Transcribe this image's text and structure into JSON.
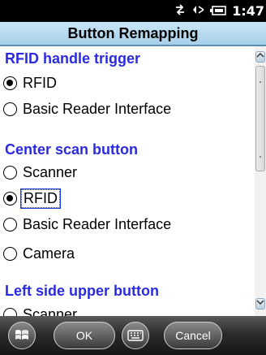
{
  "status_bar": {
    "time": "1:47",
    "icons": [
      "network-sync-icon",
      "speaker-icon",
      "battery-icon"
    ]
  },
  "title": "Button Remapping",
  "sections": [
    {
      "heading": "RFID handle trigger",
      "options": [
        {
          "label": "RFID",
          "checked": true
        },
        {
          "label": "Basic Reader Interface",
          "checked": false
        }
      ]
    },
    {
      "heading": "Center scan button",
      "options": [
        {
          "label": "Scanner",
          "checked": false
        },
        {
          "label": "RFID",
          "checked": true,
          "focused": true
        },
        {
          "label": "Basic Reader Interface",
          "checked": false
        },
        {
          "label": "Camera",
          "checked": false
        }
      ]
    },
    {
      "heading": "Left side upper button",
      "options": [
        {
          "label": "Scanner",
          "checked": false
        }
      ]
    }
  ],
  "softkeys": {
    "ok": "OK",
    "cancel": "Cancel",
    "start_icon": "windows-flag-icon",
    "keyboard_icon": "keyboard-icon"
  },
  "colors": {
    "heading": "#2a2ae0",
    "title_bar": "#b8dcf2",
    "focus": "#1a3bd6"
  }
}
